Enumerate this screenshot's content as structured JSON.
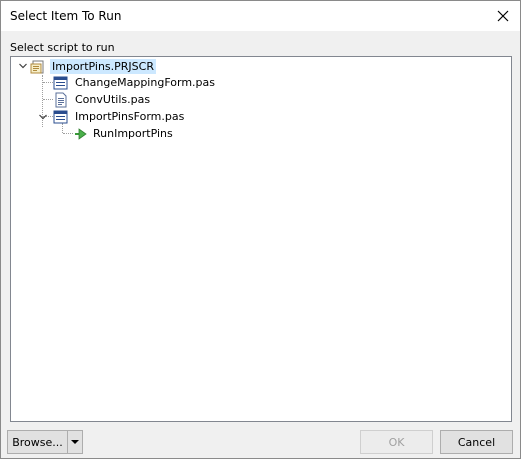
{
  "window": {
    "title": "Select Item To Run",
    "close_icon": "close-icon"
  },
  "section_label": "Select script to run",
  "tree": {
    "items": [
      {
        "label": "ImportPins.PRJSCR",
        "icon": "project-icon",
        "expanded": true,
        "selected": true
      },
      {
        "label": "ChangeMappingForm.pas",
        "icon": "form-icon"
      },
      {
        "label": "ConvUtils.pas",
        "icon": "file-icon"
      },
      {
        "label": "ImportPinsForm.pas",
        "icon": "form-icon",
        "expanded": true
      },
      {
        "label": "RunImportPins",
        "icon": "run-procedure-icon"
      }
    ]
  },
  "footer": {
    "browse_label": "Browse...",
    "browse_dropdown_icon": "chevron-down-icon",
    "ok_label": "OK",
    "ok_enabled": false,
    "cancel_label": "Cancel"
  }
}
